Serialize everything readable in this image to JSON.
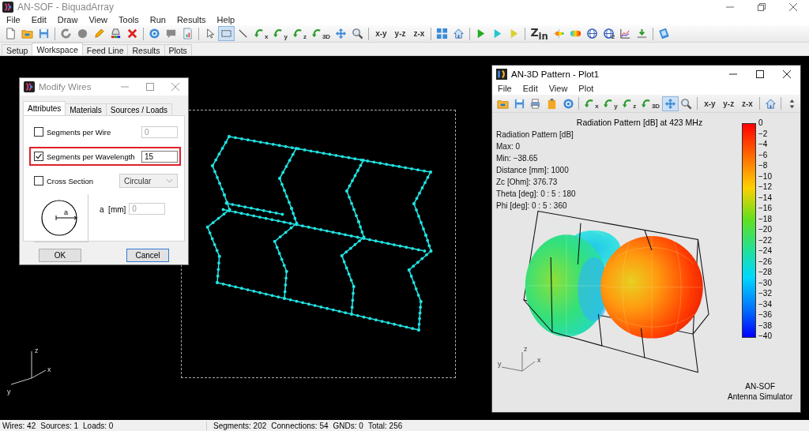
{
  "window": {
    "title": "AN-SOF - BiquadArray"
  },
  "menu": [
    "File",
    "Edit",
    "Draw",
    "View",
    "Tools",
    "Run",
    "Results",
    "Help"
  ],
  "toolbar_groups": [
    [
      {
        "kind": "new-file",
        "selected": false
      },
      {
        "kind": "folder",
        "selected": false
      },
      {
        "kind": "save",
        "selected": false
      }
    ],
    [
      {
        "kind": "refresh",
        "selected": false
      },
      {
        "kind": "circle",
        "selected": false
      },
      {
        "kind": "pencil",
        "selected": false
      },
      {
        "kind": "paint",
        "selected": false
      },
      {
        "kind": "delete",
        "selected": false
      }
    ],
    [
      {
        "kind": "gear",
        "selected": false
      },
      {
        "kind": "comment",
        "selected": false
      },
      {
        "kind": "report",
        "selected": false
      }
    ],
    [
      {
        "kind": "pointer",
        "selected": false
      },
      {
        "kind": "select",
        "selected": true
      },
      {
        "kind": "line",
        "selected": false
      },
      {
        "kind": "rotate",
        "label": "x",
        "selected": false
      },
      {
        "kind": "rotate",
        "label": "y",
        "selected": false
      },
      {
        "kind": "rotate",
        "label": "z",
        "selected": false
      },
      {
        "kind": "rotate",
        "label": "3D",
        "selected": false
      },
      {
        "kind": "pan",
        "selected": false
      },
      {
        "kind": "zoom",
        "selected": false
      }
    ],
    [
      {
        "kind": "view",
        "label": "x-y",
        "selected": false
      },
      {
        "kind": "view",
        "label": "y-z",
        "selected": false
      },
      {
        "kind": "view",
        "label": "z-x",
        "selected": false
      }
    ],
    [
      {
        "kind": "fit",
        "selected": false
      },
      {
        "kind": "home",
        "selected": false
      }
    ],
    [
      {
        "kind": "play",
        "color": "#22aa22",
        "selected": false
      },
      {
        "kind": "play",
        "color": "#22c8d0",
        "selected": false
      },
      {
        "kind": "play",
        "color": "#d8d030",
        "selected": false
      }
    ],
    [
      {
        "kind": "impedance",
        "label": "Z$_{in}$",
        "selected": false
      },
      {
        "kind": "field",
        "selected": false
      },
      {
        "kind": "gradient",
        "selected": false
      },
      {
        "kind": "globe",
        "selected": false
      },
      {
        "kind": "globe",
        "label": "2",
        "selected": false
      },
      {
        "kind": "chart",
        "selected": false
      },
      {
        "kind": "download",
        "selected": false
      }
    ],
    [
      {
        "kind": "help",
        "selected": false
      }
    ]
  ],
  "tabs": [
    {
      "label": "Setup",
      "selected": false
    },
    {
      "label": "Workspace",
      "selected": true
    },
    {
      "label": "Feed Line",
      "selected": false
    },
    {
      "label": "Results",
      "selected": false
    },
    {
      "label": "Plots",
      "selected": false
    }
  ],
  "workspace": {
    "axes": [
      "z",
      "y",
      "x"
    ],
    "dialog": {
      "title": "Modify Wires",
      "tabs": [
        {
          "label": "Attributes",
          "selected": true
        },
        {
          "label": "Materials",
          "selected": false
        },
        {
          "label": "Sources / Loads",
          "selected": false
        }
      ],
      "fields": [
        {
          "kind": "text",
          "label": "Segments per Wire",
          "checked": false,
          "value": "0",
          "highlighted": false
        },
        {
          "kind": "text",
          "label": "Segments per Wavelength",
          "checked": true,
          "value": "15",
          "highlighted": true
        },
        {
          "kind": "select",
          "label": "Cross Section",
          "checked": false,
          "value": "Circular",
          "highlighted": false
        }
      ],
      "diagram_label": "a",
      "radius": {
        "label": "a  [mm]",
        "value": "0"
      },
      "buttons": [
        {
          "label": "OK",
          "focused": false
        },
        {
          "label": "Cancel",
          "focused": true
        }
      ]
    },
    "plot_window": {
      "title": "AN-3D Pattern - Plot1",
      "menu": [
        "File",
        "Edit",
        "View",
        "Plot"
      ],
      "toolbar_groups": [
        [
          {
            "kind": "folder",
            "selected": false
          },
          {
            "kind": "save",
            "selected": false
          },
          {
            "kind": "print",
            "selected": false
          },
          {
            "kind": "clipboard",
            "selected": false
          },
          {
            "kind": "gear",
            "selected": false
          }
        ],
        [
          {
            "kind": "rotate",
            "label": "x",
            "selected": false
          },
          {
            "kind": "rotate",
            "label": "y",
            "selected": false
          },
          {
            "kind": "rotate",
            "label": "z",
            "selected": false
          },
          {
            "kind": "rotate",
            "label": "3D",
            "selected": false
          },
          {
            "kind": "pan",
            "selected": true
          },
          {
            "kind": "zoom",
            "selected": false
          }
        ],
        [
          {
            "kind": "view",
            "label": "x-y",
            "selected": false
          },
          {
            "kind": "view",
            "label": "y-z",
            "selected": false
          },
          {
            "kind": "view",
            "label": "z-x",
            "selected": false
          }
        ],
        [
          {
            "kind": "home",
            "selected": false
          }
        ],
        [
          {
            "kind": "spinner",
            "selected": false
          }
        ]
      ],
      "chart_title": "Radiation Pattern [dB] at 423 MHz",
      "info": [
        "Radiation Pattern [dB]",
        "Max: 0",
        "Min: −38.65",
        "Distance [mm]: 1000",
        "Zc [Ohm]: 376.73",
        "Theta [deg]: 0 : 5 : 180",
        "Phi [deg]: 0 : 5 : 360"
      ],
      "colorbar_ticks": [
        "0",
        "−2",
        "−4",
        "−6",
        "−8",
        "−10",
        "−12",
        "−14",
        "−16",
        "−18",
        "−20",
        "−22",
        "−24",
        "−26",
        "−28",
        "−30",
        "−32",
        "−34",
        "−36",
        "−38",
        "−40"
      ],
      "axes": [
        "z",
        "y",
        "x"
      ],
      "footer": [
        "AN-SOF",
        "Antenna Simulator"
      ]
    }
  },
  "status_bar": {
    "left": [
      "Wires: 42",
      "Sources: 1",
      "Loads: 0"
    ],
    "right": [
      "Segments: 202",
      "Connections: 54",
      "GNDs: 0",
      "Total: 256"
    ]
  }
}
